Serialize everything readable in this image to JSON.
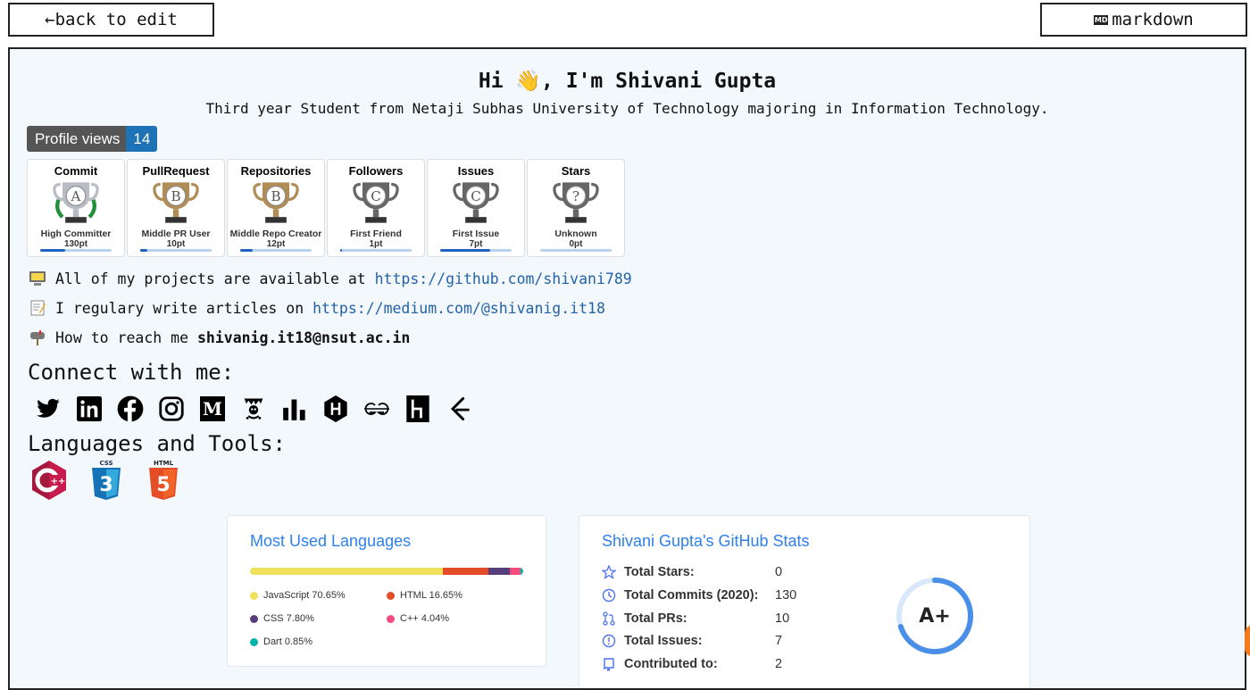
{
  "toolbar": {
    "back_label": "back to edit",
    "back_arrow": "←",
    "markdown_label": "markdown",
    "markdown_icon": "MD"
  },
  "profile": {
    "greeting": "Hi 👋, I'm Shivani Gupta",
    "subtitle": "Third year Student from Netaji Subhas University of Technology majoring in Information Technology.",
    "views_label": "Profile views",
    "views_count": "14"
  },
  "trophies": [
    {
      "title": "Commit",
      "rank": "A",
      "name": "High Committer",
      "points": "130pt",
      "progress": 0.35,
      "color": "#b9bcc4"
    },
    {
      "title": "PullRequest",
      "rank": "B",
      "name": "Middle PR User",
      "points": "10pt",
      "progress": 0.1,
      "color": "#b08d57"
    },
    {
      "title": "Repositories",
      "rank": "B",
      "name": "Middle Repo Creator",
      "points": "12pt",
      "progress": 0.18,
      "color": "#b08d57"
    },
    {
      "title": "Followers",
      "rank": "C",
      "name": "First Friend",
      "points": "1pt",
      "progress": 0.02,
      "color": "#666666"
    },
    {
      "title": "Issues",
      "rank": "C",
      "name": "First Issue",
      "points": "7pt",
      "progress": 0.7,
      "color": "#666666"
    },
    {
      "title": "Stars",
      "rank": "?",
      "name": "Unknown",
      "points": "0pt",
      "progress": 0.0,
      "color": "#666666"
    }
  ],
  "about": {
    "projects_text": "All of my projects are available at",
    "projects_link": "https://github.com/shivani789",
    "articles_text": "I regulary write articles on",
    "articles_link": "https://medium.com/@shivanig.it18",
    "reach_text": "How to reach me",
    "reach_email": "shivanig.it18@nsut.ac.in"
  },
  "connect_heading": "Connect with me:",
  "socials": [
    "twitter-icon",
    "linkedin-icon",
    "facebook-icon",
    "instagram-icon",
    "medium-icon",
    "kaggle-icon",
    "chart-icon",
    "hackerrank-icon",
    "geeksforgeeks-icon",
    "hackerearth-icon",
    "leetcode-icon"
  ],
  "languages_heading": "Languages and Tools:",
  "tools": [
    "cplusplus-icon",
    "css3-icon",
    "html5-icon"
  ],
  "lang_card": {
    "title": "Most Used Languages",
    "items": [
      {
        "label": "JavaScript 70.65%",
        "pct": 70.65,
        "color": "#f1e05a"
      },
      {
        "label": "HTML 16.65%",
        "pct": 16.65,
        "color": "#e34c26"
      },
      {
        "label": "CSS 7.80%",
        "pct": 7.8,
        "color": "#563d7c"
      },
      {
        "label": "C++ 4.04%",
        "pct": 4.04,
        "color": "#f34b7d"
      },
      {
        "label": "Dart 0.85%",
        "pct": 0.85,
        "color": "#00b4ab"
      }
    ]
  },
  "stats_card": {
    "title": "Shivani Gupta's GitHub Stats",
    "rows": [
      {
        "label": "Total Stars:",
        "value": "0",
        "icon": "star-icon"
      },
      {
        "label": "Total Commits (2020):",
        "value": "130",
        "icon": "history-icon"
      },
      {
        "label": "Total PRs:",
        "value": "10",
        "icon": "pull-request-icon"
      },
      {
        "label": "Total Issues:",
        "value": "7",
        "icon": "issue-icon"
      },
      {
        "label": "Contributed to:",
        "value": "2",
        "icon": "repo-icon"
      }
    ],
    "grade": "A+",
    "grade_progress": 0.7
  }
}
